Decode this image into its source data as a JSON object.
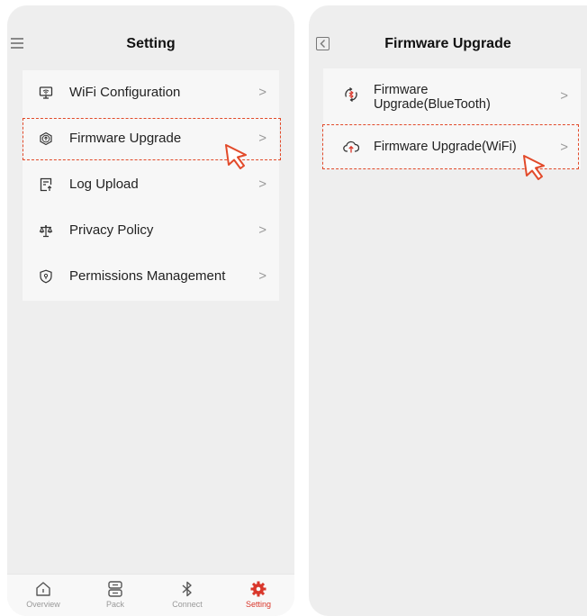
{
  "left_screen": {
    "title": "Setting",
    "items": [
      {
        "label": "WiFi Configuration",
        "icon": "wifi-monitor-icon"
      },
      {
        "label": "Firmware Upgrade",
        "icon": "upload-circle-icon",
        "highlighted": true
      },
      {
        "label": "Log Upload",
        "icon": "log-upload-icon"
      },
      {
        "label": "Privacy Policy",
        "icon": "scale-icon"
      },
      {
        "label": "Permissions Management",
        "icon": "shield-icon"
      }
    ],
    "chevron": ">",
    "tabs": [
      {
        "label": "Overview",
        "icon": "home-icon"
      },
      {
        "label": "Pack",
        "icon": "battery-pack-icon"
      },
      {
        "label": "Connect",
        "icon": "bluetooth-icon"
      },
      {
        "label": "Setting",
        "icon": "gear-icon",
        "active": true
      }
    ]
  },
  "right_screen": {
    "title": "Firmware Upgrade",
    "items": [
      {
        "label_line1": "Firmware",
        "label_line2": "Upgrade(BlueTooth)",
        "icon": "bluetooth-refresh-icon"
      },
      {
        "label": "Firmware Upgrade(WiFi)",
        "icon": "cloud-upload-icon",
        "highlighted": true
      }
    ],
    "chevron": ">"
  },
  "colors": {
    "highlight": "#e24a2a",
    "active_tab": "#d9372b"
  }
}
